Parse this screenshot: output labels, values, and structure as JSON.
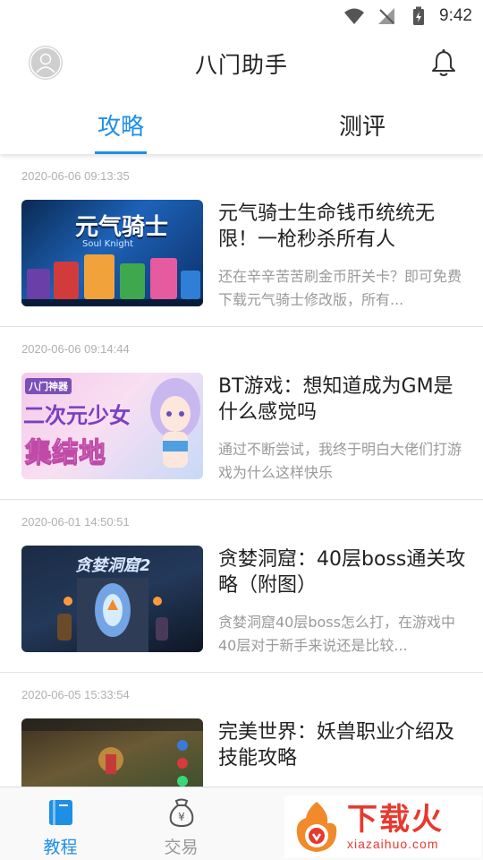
{
  "status_bar": {
    "time": "9:42"
  },
  "header": {
    "title": "八门助手"
  },
  "tabs": [
    {
      "label": "攻略",
      "active": true
    },
    {
      "label": "测评",
      "active": false
    }
  ],
  "feed": [
    {
      "date": "2020-06-06 09:13:35",
      "title": "元气骑士生命钱币统统无限！一枪秒杀所有人",
      "desc": "还在辛辛苦苦刷金币肝关卡？即可免费下载元气骑士修改版，所有...",
      "thumb_text": "元气骑士",
      "thumb_subtext": "Soul Knight"
    },
    {
      "date": "2020-06-06 09:14:44",
      "title": "BT游戏：想知道成为GM是什么感觉吗",
      "desc": "通过不断尝试，我终于明白大佬们打游戏为什么这样快乐",
      "thumb_badge": "八门神器",
      "thumb_text": "二次元少女",
      "thumb_text2": "集结地"
    },
    {
      "date": "2020-06-01 14:50:51",
      "title": "贪婪洞窟：40层boss通关攻略（附图）",
      "desc": " 贪婪洞窟40层boss怎么打，在游戏中40层对于新手来说还是比较...",
      "thumb_text": "贪婪洞窟2"
    },
    {
      "date": "2020-06-05 15:33:54",
      "title": "完美世界：妖兽职业介绍及技能攻略",
      "desc": ""
    }
  ],
  "bottom_nav": [
    {
      "label": "教程",
      "icon": "book-icon",
      "active": true
    },
    {
      "label": "交易",
      "icon": "money-bag-icon",
      "active": false
    }
  ],
  "watermark": {
    "cn": "下载火",
    "en": "xiazaihuo.com"
  },
  "colors": {
    "accent": "#1f8fe6",
    "watermark": "#e8392e"
  }
}
